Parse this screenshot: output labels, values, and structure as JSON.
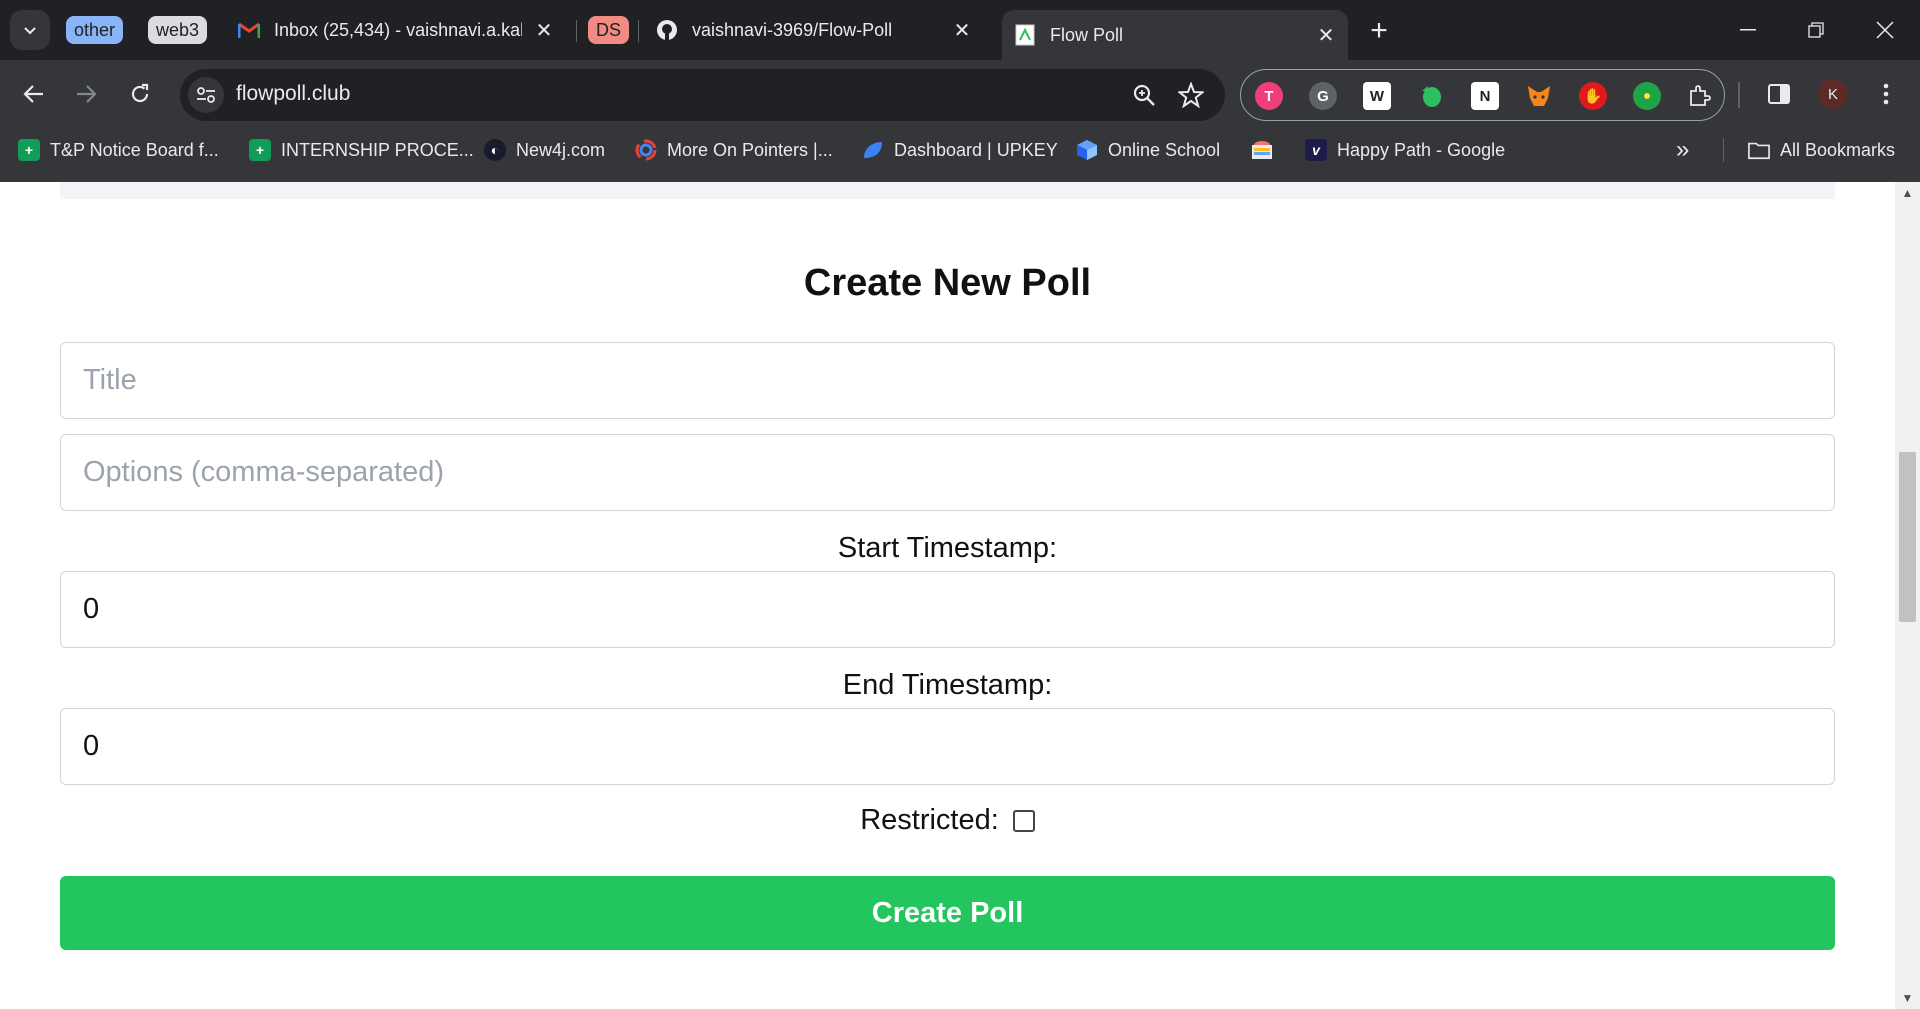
{
  "tabstrip": {
    "groups": [
      {
        "label": "other",
        "bg": "#8ab4f8",
        "fg": "#202124"
      },
      {
        "label": "web3",
        "bg": "#dadce0",
        "fg": "#202124"
      },
      {
        "label": "DS",
        "bg": "#f28b82",
        "fg": "#202124"
      }
    ],
    "tabs": [
      {
        "title": "Inbox (25,434) - vaishnavi.a.kale",
        "icon": "gmail-icon"
      },
      {
        "title": "vaishnavi-3969/Flow-Poll",
        "icon": "github-icon"
      },
      {
        "title": "Flow Poll",
        "icon": "flow-poll-icon",
        "active": true
      }
    ]
  },
  "toolbar": {
    "url": "flowpoll.club",
    "profile_initial": "K"
  },
  "bookmarks": {
    "items": [
      {
        "label": "T&P Notice Board f...",
        "icon": "sheets-icon"
      },
      {
        "label": "INTERNSHIP PROCE...",
        "icon": "sheets-icon"
      },
      {
        "label": "New4j.com",
        "icon": "new4j-icon"
      },
      {
        "label": "More On Pointers |...",
        "icon": "pointers-icon"
      },
      {
        "label": "Dashboard | UPKEY",
        "icon": "upkey-icon"
      },
      {
        "label": "Online School",
        "icon": "school-icon"
      },
      {
        "label": "",
        "icon": "rainbow-icon"
      },
      {
        "label": "Happy Path - Google",
        "icon": "happy-path-icon"
      }
    ],
    "all_bookmarks": "All Bookmarks"
  },
  "page": {
    "heading": "Create New Poll",
    "title_placeholder": "Title",
    "options_placeholder": "Options (comma-separated)",
    "start_label": "Start Timestamp:",
    "start_value": "0",
    "end_label": "End Timestamp:",
    "end_value": "0",
    "restricted_label": "Restricted:",
    "restricted_checked": false,
    "create_button": "Create Poll"
  },
  "colors": {
    "accent_green": "#22c55e",
    "chrome_dark": "#202124",
    "chrome_toolbar": "#35363a"
  }
}
